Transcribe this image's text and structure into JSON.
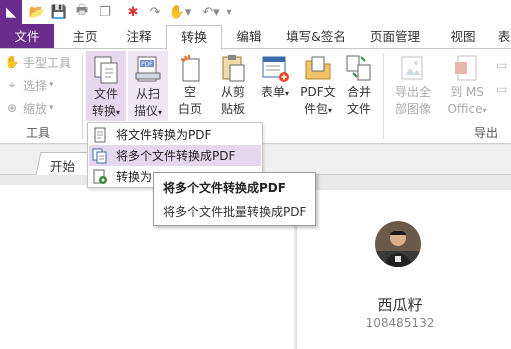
{
  "ribbon_tabs": [
    "文件",
    "主页",
    "注释",
    "转换",
    "编辑",
    "填写&签名",
    "页面管理",
    "视图",
    "表"
  ],
  "ribbon": {
    "tools_group": {
      "hand": "手型工具",
      "select": "选择",
      "zoom": "缩放",
      "label": "工具"
    },
    "convert_file": [
      "文件",
      "转换"
    ],
    "from_scanner": [
      "从扫",
      "描仪"
    ],
    "blank_page": [
      "空",
      "白页"
    ],
    "from_clipboard": [
      "从剪",
      "贴板"
    ],
    "form": "表单",
    "pdf_package": [
      "PDF文",
      "件包"
    ],
    "merge": [
      "合并",
      "文件"
    ],
    "export_images": [
      "导出全",
      "部图像"
    ],
    "to_ms_office": [
      "到 MS",
      "Office"
    ],
    "export_label": "导出"
  },
  "doc_tab": "开始",
  "menu": {
    "items": [
      "将文件转换为PDF",
      "将多个文件转换成PDF",
      "转换为"
    ]
  },
  "tooltip": {
    "title": "将多个文件转换成PDF",
    "desc": "将多个文件批量转换成PDF"
  },
  "profile": {
    "name": "西瓜籽",
    "id": "108485132"
  },
  "colors": {
    "brand": "#6a2c8c",
    "highlight": "#e4d7ee"
  }
}
